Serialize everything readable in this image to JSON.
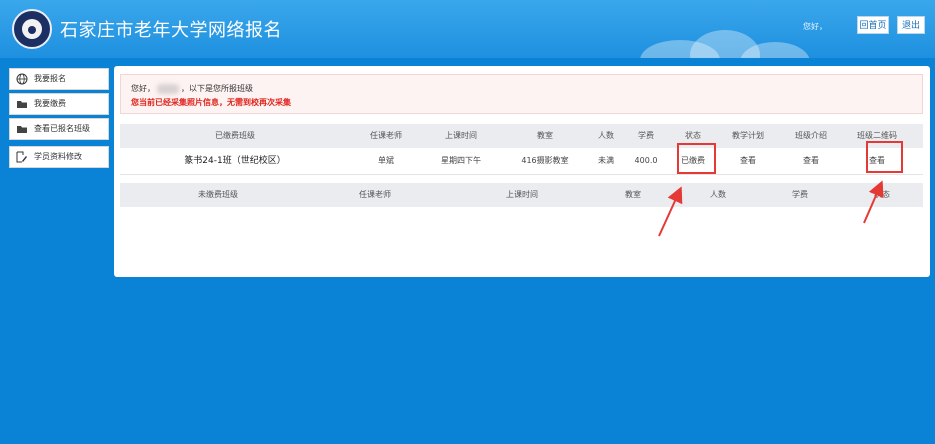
{
  "header": {
    "title": "石家庄市老年大学网络报名",
    "greeting": "您好，",
    "home_label": "回首页",
    "logout_label": "退出"
  },
  "sidebar": {
    "items": [
      {
        "label": "我要报名",
        "icon": "globe-icon"
      },
      {
        "label": "我要缴费",
        "icon": "folder-icon"
      },
      {
        "label": "查看已报名班级",
        "icon": "folder-icon"
      },
      {
        "label": "学员资料修改",
        "icon": "edit-icon"
      }
    ]
  },
  "notice": {
    "line1_prefix": "您好，",
    "line1_suffix": "，以下是您所报班级",
    "line2": "您当前已经采集照片信息，无需到校再次采集"
  },
  "paid_table": {
    "headers": [
      "已缴费班级",
      "任课老师",
      "上课时间",
      "教室",
      "人数",
      "学费",
      "状态",
      "教学计划",
      "班级介绍",
      "班级二维码"
    ],
    "rows": [
      [
        "篆书24-1班（世纪校区）",
        "单斌",
        "星期四下午",
        "416摄影教室",
        "未满",
        "400.0",
        "已缴费",
        "查看",
        "查看",
        "查看"
      ]
    ]
  },
  "unpaid_table": {
    "headers": [
      "未缴费班级",
      "任课老师",
      "上课时间",
      "教室",
      "人数",
      "学费",
      "状态"
    ]
  },
  "colors": {
    "page_bg": "#0a82d6",
    "annotation_red": "#e53935",
    "notice_red": "#e0221c"
  }
}
